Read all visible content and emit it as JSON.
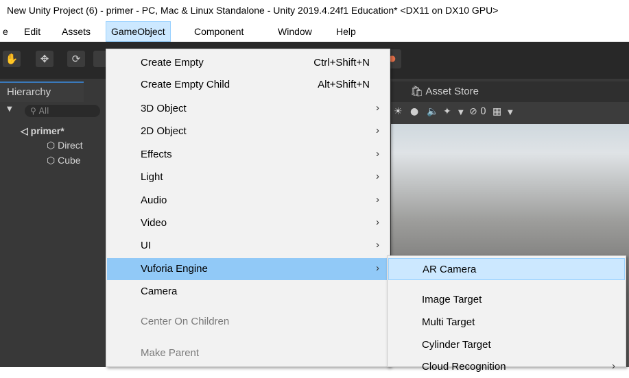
{
  "window": {
    "title": "New Unity Project (6) - primer - PC, Mac & Linux Standalone - Unity 2019.4.24f1 Education* <DX11 on DX10 GPU>"
  },
  "menubar": {
    "items": [
      {
        "label": "e"
      },
      {
        "label": "Edit"
      },
      {
        "label": "Assets"
      },
      {
        "label": "GameObject"
      },
      {
        "label": "Component"
      },
      {
        "label": "Window"
      },
      {
        "label": "Help"
      }
    ]
  },
  "hierarchy": {
    "tab_label": "Hierarchy",
    "search_placeholder": "All",
    "scene_name": "primer*",
    "objects": [
      "Direct",
      "Cube"
    ]
  },
  "scene": {
    "asset_store_tab": "Asset Store",
    "hidden_count": "0"
  },
  "gameobject_menu": {
    "items": [
      {
        "label": "Create Empty",
        "shortcut": "Ctrl+Shift+N"
      },
      {
        "label": "Create Empty Child",
        "shortcut": "Alt+Shift+N"
      },
      {
        "label": "3D Object",
        "submenu": true
      },
      {
        "label": "2D Object",
        "submenu": true
      },
      {
        "label": "Effects",
        "submenu": true
      },
      {
        "label": "Light",
        "submenu": true
      },
      {
        "label": "Audio",
        "submenu": true
      },
      {
        "label": "Video",
        "submenu": true
      },
      {
        "label": "UI",
        "submenu": true
      },
      {
        "label": "Vuforia Engine",
        "submenu": true,
        "highlighted": true
      },
      {
        "label": "Camera"
      },
      {
        "label": "Center On Children",
        "disabled": true
      },
      {
        "label": "Make Parent",
        "disabled": true
      }
    ]
  },
  "vuforia_submenu": {
    "items": [
      {
        "label": "AR Camera",
        "highlighted": true
      },
      {
        "label": "Image Target"
      },
      {
        "label": "Multi Target"
      },
      {
        "label": "Cylinder Target"
      },
      {
        "label": "Cloud Recognition",
        "submenu": true
      }
    ]
  },
  "colors": {
    "menu_highlight": "#91c9f7",
    "submenu_highlight": "#cce8ff",
    "editor_dark": "#383838",
    "collab_accent": "#e4704a"
  }
}
